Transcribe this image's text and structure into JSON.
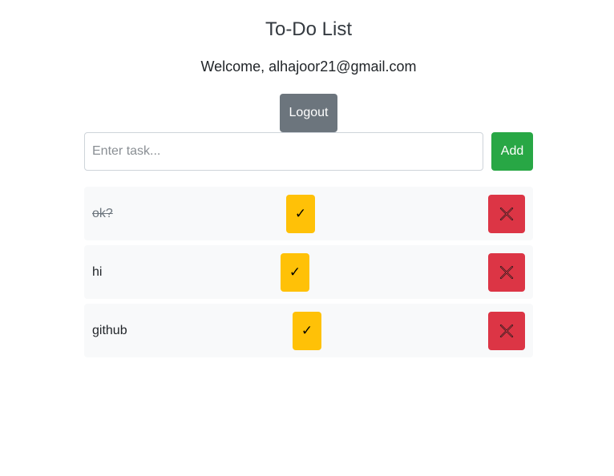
{
  "header": {
    "title": "To-Do List",
    "welcome": "Welcome, alhajoor21@gmail.com",
    "logout_label": "Logout"
  },
  "new_task": {
    "placeholder": "Enter task...",
    "value": "",
    "add_label": "Add"
  },
  "tasks": [
    {
      "text": "ok?",
      "completed": true,
      "complete_icon": "✓",
      "delete_icon": "close-x-icon"
    },
    {
      "text": "hi",
      "completed": false,
      "complete_icon": "✓",
      "delete_icon": "close-x-icon"
    },
    {
      "text": "github",
      "completed": false,
      "complete_icon": "✓",
      "delete_icon": "close-x-icon"
    }
  ],
  "colors": {
    "logout": "#6c757d",
    "add": "#28a745",
    "complete": "#ffc107",
    "delete": "#dc3545",
    "task_bg": "#f8f9fa"
  }
}
